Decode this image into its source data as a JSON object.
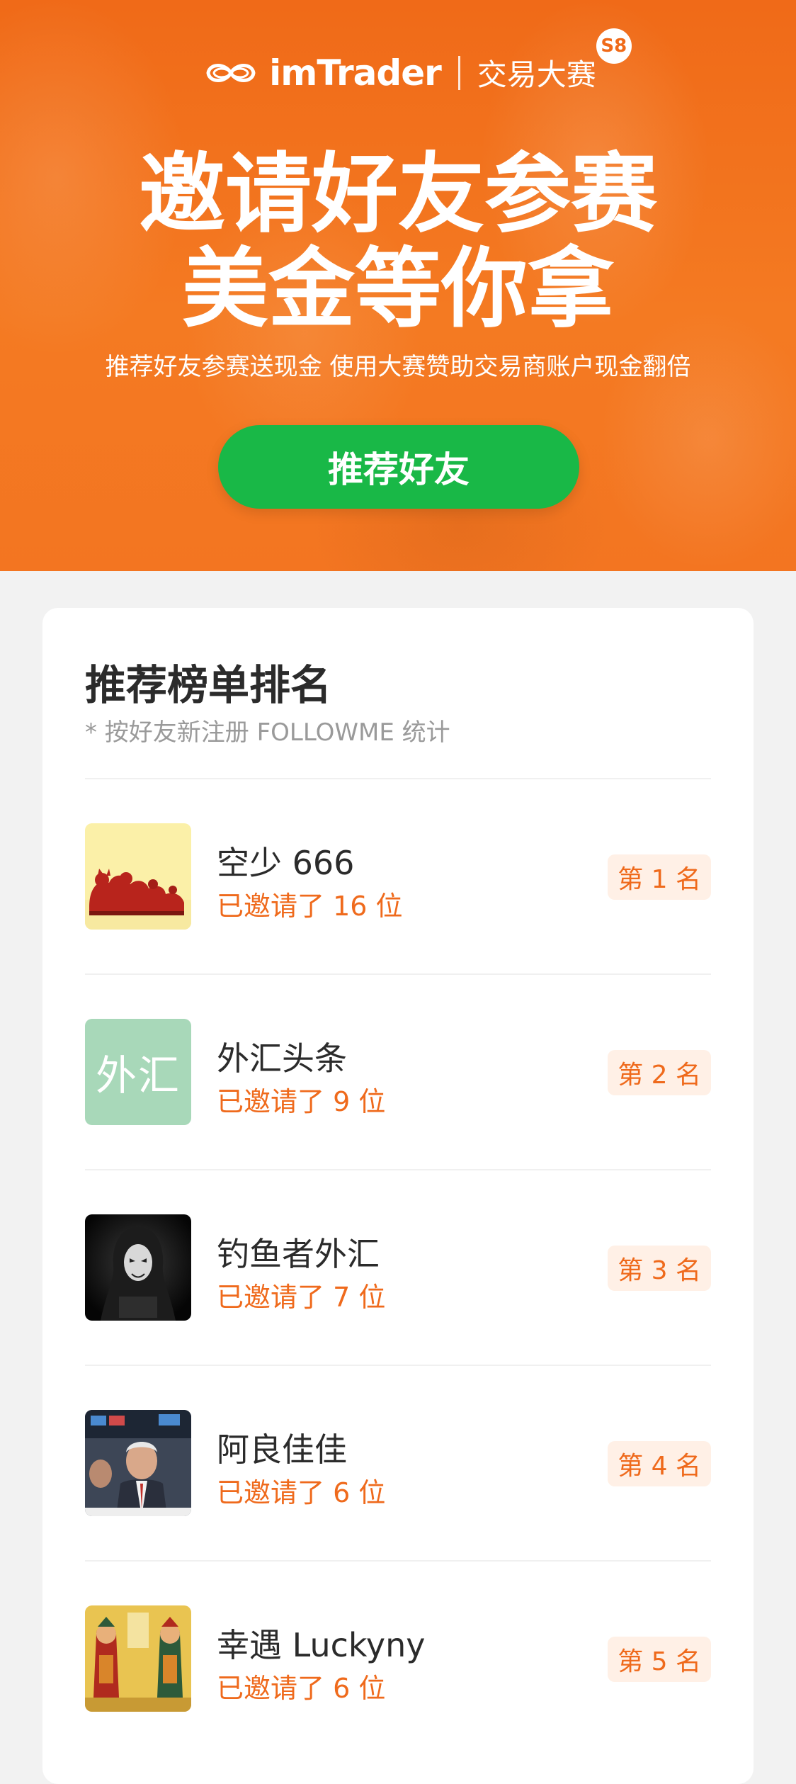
{
  "hero": {
    "brand": "imTrader",
    "contest_label": "交易大赛",
    "badge": "S8",
    "headline_line1": "邀请好友参赛",
    "headline_line2": "美金等你拿",
    "subheadline": "推荐好友参赛送现金 使用大赛赞助交易商账户现金翻倍",
    "cta_label": "推荐好友"
  },
  "leaderboard": {
    "title": "推荐榜单排名",
    "note": "* 按好友新注册 FOLLOWME 统计",
    "entries": [
      {
        "name": "空少 666",
        "invited": "已邀请了 16 位",
        "rank": "第 1 名",
        "avatar": "cartoon-cats-avatar"
      },
      {
        "name": "外汇头条",
        "invited": "已邀请了 9 位",
        "rank": "第 2 名",
        "avatar": "text-avatar",
        "avatar_text": "外汇",
        "avatar_color": "#a8d8b9"
      },
      {
        "name": "钓鱼者外汇",
        "invited": "已邀请了 7 位",
        "rank": "第 3 名",
        "avatar": "hooded-figure-avatar"
      },
      {
        "name": "阿良佳佳",
        "invited": "已邀请了 6 位",
        "rank": "第 4 名",
        "avatar": "trading-floor-photo-avatar"
      },
      {
        "name": "幸遇 Luckyny",
        "invited": "已邀请了 6 位",
        "rank": "第 5 名",
        "avatar": "door-gods-avatar"
      }
    ]
  },
  "colors": {
    "hero_orange": "#f06a18",
    "cta_green": "#19b847",
    "accent_orange": "#ef6a1c",
    "rank_bg": "#fff0e6"
  }
}
